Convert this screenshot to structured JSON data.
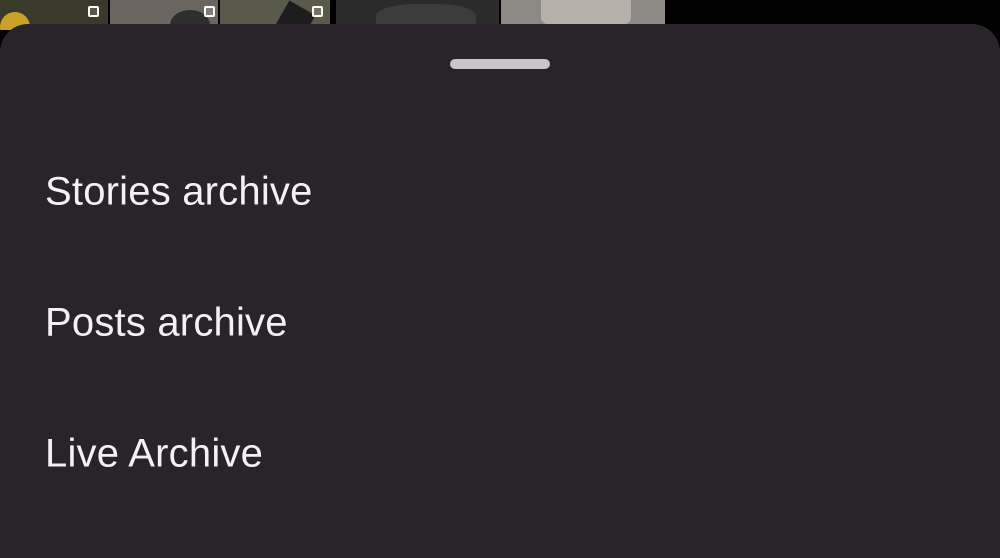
{
  "sheet": {
    "background": "#28242a",
    "handle_color": "#c7c6c8",
    "items": [
      {
        "label": "Stories archive"
      },
      {
        "label": "Posts archive"
      },
      {
        "label": "Live Archive"
      }
    ]
  },
  "background_grid": {
    "thumbnails": [
      {
        "color": "#3a3a2a",
        "icon": "multi-photo-icon"
      },
      {
        "color": "#6b6560",
        "icon": "multi-photo-icon"
      },
      {
        "color": "#5a5a4a",
        "icon": "multi-photo-icon"
      },
      {
        "color": "#2b2b2b",
        "icon": ""
      },
      {
        "color": "#8d8a85",
        "icon": ""
      }
    ]
  }
}
